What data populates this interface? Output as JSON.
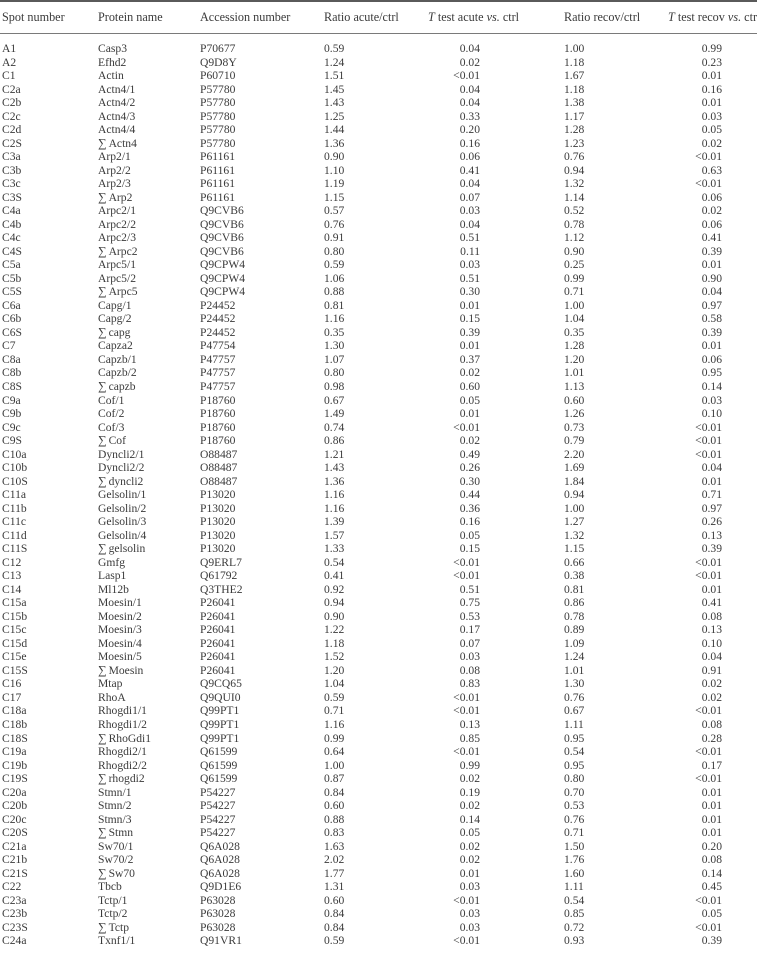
{
  "table": {
    "headers": [
      {
        "text": "Spot number"
      },
      {
        "text": "Protein name"
      },
      {
        "text": "Accession number"
      },
      {
        "text": "Ratio acute/ctrl"
      },
      {
        "italic": "T",
        "text": " test acute ",
        "italic2": "vs.",
        "text2": " ctrl"
      },
      {
        "text": "Ratio recov/ctrl"
      },
      {
        "italic": "T",
        "text": " test recov ",
        "italic2": "vs.",
        "text2": " ctrl"
      }
    ],
    "rows": [
      {
        "spot": "A1",
        "sum": false,
        "name": "Casp3",
        "acc": "P70677",
        "ra": "0.59",
        "ta": "0.04",
        "rr": "1.00",
        "tr": "0.99"
      },
      {
        "spot": "A2",
        "sum": false,
        "name": "Efhd2",
        "acc": "Q9D8Y",
        "ra": "1.24",
        "ta": "0.02",
        "rr": "1.18",
        "tr": "0.23"
      },
      {
        "spot": "C1",
        "sum": false,
        "name": "Actin",
        "acc": "P60710",
        "ra": "1.51",
        "ta": "<0.01",
        "rr": "1.67",
        "tr": "0.01"
      },
      {
        "spot": "C2a",
        "sum": false,
        "name": "Actn4/1",
        "acc": "P57780",
        "ra": "1.45",
        "ta": "0.04",
        "rr": "1.18",
        "tr": "0.16"
      },
      {
        "spot": "C2b",
        "sum": false,
        "name": "Actn4/2",
        "acc": "P57780",
        "ra": "1.43",
        "ta": "0.04",
        "rr": "1.38",
        "tr": "0.01"
      },
      {
        "spot": "C2c",
        "sum": false,
        "name": "Actn4/3",
        "acc": "P57780",
        "ra": "1.25",
        "ta": "0.33",
        "rr": "1.17",
        "tr": "0.03"
      },
      {
        "spot": "C2d",
        "sum": false,
        "name": "Actn4/4",
        "acc": "P57780",
        "ra": "1.44",
        "ta": "0.20",
        "rr": "1.28",
        "tr": "0.05"
      },
      {
        "spot": "C2S",
        "sum": true,
        "name": "Actn4",
        "acc": "P57780",
        "ra": "1.36",
        "ta": "0.16",
        "rr": "1.23",
        "tr": "0.02"
      },
      {
        "spot": "C3a",
        "sum": false,
        "name": "Arp2/1",
        "acc": "P61161",
        "ra": "0.90",
        "ta": "0.06",
        "rr": "0.76",
        "tr": "<0.01"
      },
      {
        "spot": "C3b",
        "sum": false,
        "name": "Arp2/2",
        "acc": "P61161",
        "ra": "1.10",
        "ta": "0.41",
        "rr": "0.94",
        "tr": "0.63"
      },
      {
        "spot": "C3c",
        "sum": false,
        "name": "Arp2/3",
        "acc": "P61161",
        "ra": "1.19",
        "ta": "0.04",
        "rr": "1.32",
        "tr": "<0.01"
      },
      {
        "spot": "C3S",
        "sum": true,
        "name": "Arp2",
        "acc": "P61161",
        "ra": "1.15",
        "ta": "0.07",
        "rr": "1.14",
        "tr": "0.06"
      },
      {
        "spot": "C4a",
        "sum": false,
        "name": "Arpc2/1",
        "acc": "Q9CVB6",
        "ra": "0.57",
        "ta": "0.03",
        "rr": "0.52",
        "tr": "0.02"
      },
      {
        "spot": "C4b",
        "sum": false,
        "name": "Arpc2/2",
        "acc": "Q9CVB6",
        "ra": "0.76",
        "ta": "0.04",
        "rr": "0.78",
        "tr": "0.06"
      },
      {
        "spot": "C4c",
        "sum": false,
        "name": "Arpc2/3",
        "acc": "Q9CVB6",
        "ra": "0.91",
        "ta": "0.51",
        "rr": "1.12",
        "tr": "0.41"
      },
      {
        "spot": "C4S",
        "sum": true,
        "name": "Arpc2",
        "acc": "Q9CVB6",
        "ra": "0.80",
        "ta": "0.11",
        "rr": "0.90",
        "tr": "0.39"
      },
      {
        "spot": "C5a",
        "sum": false,
        "name": "Arpc5/1",
        "acc": "Q9CPW4",
        "ra": "0.59",
        "ta": "0.03",
        "rr": "0.25",
        "tr": "0.01"
      },
      {
        "spot": "C5b",
        "sum": false,
        "name": "Arpc5/2",
        "acc": "Q9CPW4",
        "ra": "1.06",
        "ta": "0.51",
        "rr": "0.99",
        "tr": "0.90"
      },
      {
        "spot": "C5S",
        "sum": true,
        "name": "Arpc5",
        "acc": "Q9CPW4",
        "ra": "0.88",
        "ta": "0.30",
        "rr": "0.71",
        "tr": "0.04"
      },
      {
        "spot": "C6a",
        "sum": false,
        "name": "Capg/1",
        "acc": "P24452",
        "ra": "0.81",
        "ta": "0.01",
        "rr": "1.00",
        "tr": "0.97"
      },
      {
        "spot": "C6b",
        "sum": false,
        "name": "Capg/2",
        "acc": "P24452",
        "ra": "1.16",
        "ta": "0.15",
        "rr": "1.04",
        "tr": "0.58"
      },
      {
        "spot": "C6S",
        "sum": true,
        "name": "capg",
        "acc": "P24452",
        "ra": "0.35",
        "ta": "0.39",
        "rr": "0.35",
        "tr": "0.39"
      },
      {
        "spot": "C7",
        "sum": false,
        "name": "Capza2",
        "acc": "P47754",
        "ra": "1.30",
        "ta": "0.01",
        "rr": "1.28",
        "tr": "0.01"
      },
      {
        "spot": "C8a",
        "sum": false,
        "name": "Capzb/1",
        "acc": "P47757",
        "ra": "1.07",
        "ta": "0.37",
        "rr": "1.20",
        "tr": "0.06"
      },
      {
        "spot": "C8b",
        "sum": false,
        "name": "Capzb/2",
        "acc": "P47757",
        "ra": "0.80",
        "ta": "0.02",
        "rr": "1.01",
        "tr": "0.95"
      },
      {
        "spot": "C8S",
        "sum": true,
        "name": "capzb",
        "acc": "P47757",
        "ra": "0.98",
        "ta": "0.60",
        "rr": "1.13",
        "tr": "0.14"
      },
      {
        "spot": "C9a",
        "sum": false,
        "name": "Cof/1",
        "acc": "P18760",
        "ra": "0.67",
        "ta": "0.05",
        "rr": "0.60",
        "tr": "0.03"
      },
      {
        "spot": "C9b",
        "sum": false,
        "name": "Cof/2",
        "acc": "P18760",
        "ra": "1.49",
        "ta": "0.01",
        "rr": "1.26",
        "tr": "0.10"
      },
      {
        "spot": "C9c",
        "sum": false,
        "name": "Cof/3",
        "acc": "P18760",
        "ra": "0.74",
        "ta": "<0.01",
        "rr": "0.73",
        "tr": "<0.01"
      },
      {
        "spot": "C9S",
        "sum": true,
        "name": "Cof",
        "acc": "P18760",
        "ra": "0.86",
        "ta": "0.02",
        "rr": "0.79",
        "tr": "<0.01"
      },
      {
        "spot": "C10a",
        "sum": false,
        "name": "Dyncli2/1",
        "acc": "O88487",
        "ra": "1.21",
        "ta": "0.49",
        "rr": "2.20",
        "tr": "<0.01"
      },
      {
        "spot": "C10b",
        "sum": false,
        "name": "Dyncli2/2",
        "acc": "O88487",
        "ra": "1.43",
        "ta": "0.26",
        "rr": "1.69",
        "tr": "0.04"
      },
      {
        "spot": "C10S",
        "sum": true,
        "name": "dyncli2",
        "acc": "O88487",
        "ra": "1.36",
        "ta": "0.30",
        "rr": "1.84",
        "tr": "0.01"
      },
      {
        "spot": "C11a",
        "sum": false,
        "name": "Gelsolin/1",
        "acc": "P13020",
        "ra": "1.16",
        "ta": "0.44",
        "rr": "0.94",
        "tr": "0.71"
      },
      {
        "spot": "C11b",
        "sum": false,
        "name": "Gelsolin/2",
        "acc": "P13020",
        "ra": "1.16",
        "ta": "0.36",
        "rr": "1.00",
        "tr": "0.97"
      },
      {
        "spot": "C11c",
        "sum": false,
        "name": "Gelsolin/3",
        "acc": "P13020",
        "ra": "1.39",
        "ta": "0.16",
        "rr": "1.27",
        "tr": "0.26"
      },
      {
        "spot": "C11d",
        "sum": false,
        "name": "Gelsolin/4",
        "acc": "P13020",
        "ra": "1.57",
        "ta": "0.05",
        "rr": "1.32",
        "tr": "0.13"
      },
      {
        "spot": "C11S",
        "sum": true,
        "name": "gelsolin",
        "acc": "P13020",
        "ra": "1.33",
        "ta": "0.15",
        "rr": "1.15",
        "tr": "0.39"
      },
      {
        "spot": "C12",
        "sum": false,
        "name": "Gmfg",
        "acc": "Q9ERL7",
        "ra": "0.54",
        "ta": "<0.01",
        "rr": "0.66",
        "tr": "<0.01"
      },
      {
        "spot": "C13",
        "sum": false,
        "name": "Lasp1",
        "acc": "Q61792",
        "ra": "0.41",
        "ta": "<0.01",
        "rr": "0.38",
        "tr": "<0.01"
      },
      {
        "spot": "C14",
        "sum": false,
        "name": "Ml12b",
        "acc": "Q3THE2",
        "ra": "0.92",
        "ta": "0.51",
        "rr": "0.81",
        "tr": "0.01"
      },
      {
        "spot": "C15a",
        "sum": false,
        "name": "Moesin/1",
        "acc": "P26041",
        "ra": "0.94",
        "ta": "0.75",
        "rr": "0.86",
        "tr": "0.41"
      },
      {
        "spot": "C15b",
        "sum": false,
        "name": "Moesin/2",
        "acc": "P26041",
        "ra": "0.90",
        "ta": "0.53",
        "rr": "0.78",
        "tr": "0.08"
      },
      {
        "spot": "C15c",
        "sum": false,
        "name": "Moesin/3",
        "acc": "P26041",
        "ra": "1.22",
        "ta": "0.17",
        "rr": "0.89",
        "tr": "0.13"
      },
      {
        "spot": "C15d",
        "sum": false,
        "name": "Moesin/4",
        "acc": "P26041",
        "ra": "1.18",
        "ta": "0.07",
        "rr": "1.09",
        "tr": "0.10"
      },
      {
        "spot": "C15e",
        "sum": false,
        "name": "Moesin/5",
        "acc": "P26041",
        "ra": "1.52",
        "ta": "0.03",
        "rr": "1.24",
        "tr": "0.04"
      },
      {
        "spot": "C15S",
        "sum": true,
        "name": "Moesin",
        "acc": "P26041",
        "ra": "1.20",
        "ta": "0.08",
        "rr": "1.01",
        "tr": "0.91"
      },
      {
        "spot": "C16",
        "sum": false,
        "name": "Mtap",
        "acc": "Q9CQ65",
        "ra": "1.04",
        "ta": "0.83",
        "rr": "1.30",
        "tr": "0.02"
      },
      {
        "spot": "C17",
        "sum": false,
        "name": "RhoA",
        "acc": "Q9QUI0",
        "ra": "0.59",
        "ta": "<0.01",
        "rr": "0.76",
        "tr": "0.02"
      },
      {
        "spot": "C18a",
        "sum": false,
        "name": "Rhogdi1/1",
        "acc": "Q99PT1",
        "ra": "0.71",
        "ta": "<0.01",
        "rr": "0.67",
        "tr": "<0.01"
      },
      {
        "spot": "C18b",
        "sum": false,
        "name": "Rhogdi1/2",
        "acc": "Q99PT1",
        "ra": "1.16",
        "ta": "0.13",
        "rr": "1.11",
        "tr": "0.08"
      },
      {
        "spot": "C18S",
        "sum": true,
        "name": "RhoGdi1",
        "acc": "Q99PT1",
        "ra": "0.99",
        "ta": "0.85",
        "rr": "0.95",
        "tr": "0.28"
      },
      {
        "spot": "C19a",
        "sum": false,
        "name": "Rhogdi2/1",
        "acc": "Q61599",
        "ra": "0.64",
        "ta": "<0.01",
        "rr": "0.54",
        "tr": "<0.01"
      },
      {
        "spot": "C19b",
        "sum": false,
        "name": "Rhogdi2/2",
        "acc": "Q61599",
        "ra": "1.00",
        "ta": "0.99",
        "rr": "0.95",
        "tr": "0.17"
      },
      {
        "spot": "C19S",
        "sum": true,
        "name": "rhogdi2",
        "acc": "Q61599",
        "ra": "0.87",
        "ta": "0.02",
        "rr": "0.80",
        "tr": "<0.01"
      },
      {
        "spot": "C20a",
        "sum": false,
        "name": "Stmn/1",
        "acc": "P54227",
        "ra": "0.84",
        "ta": "0.19",
        "rr": "0.70",
        "tr": "0.01"
      },
      {
        "spot": "C20b",
        "sum": false,
        "name": "Stmn/2",
        "acc": "P54227",
        "ra": "0.60",
        "ta": "0.02",
        "rr": "0.53",
        "tr": "0.01"
      },
      {
        "spot": "C20c",
        "sum": false,
        "name": "Stmn/3",
        "acc": "P54227",
        "ra": "0.88",
        "ta": "0.14",
        "rr": "0.76",
        "tr": "0.01"
      },
      {
        "spot": "C20S",
        "sum": true,
        "name": "Stmn",
        "acc": "P54227",
        "ra": "0.83",
        "ta": "0.05",
        "rr": "0.71",
        "tr": "0.01"
      },
      {
        "spot": "C21a",
        "sum": false,
        "name": "Sw70/1",
        "acc": "Q6A028",
        "ra": "1.63",
        "ta": "0.02",
        "rr": "1.50",
        "tr": "0.20"
      },
      {
        "spot": "C21b",
        "sum": false,
        "name": "Sw70/2",
        "acc": "Q6A028",
        "ra": "2.02",
        "ta": "0.02",
        "rr": "1.76",
        "tr": "0.08"
      },
      {
        "spot": "C21S",
        "sum": true,
        "name": "Sw70",
        "acc": "Q6A028",
        "ra": "1.77",
        "ta": "0.01",
        "rr": "1.60",
        "tr": "0.14"
      },
      {
        "spot": "C22",
        "sum": false,
        "name": "Tbcb",
        "acc": "Q9D1E6",
        "ra": "1.31",
        "ta": "0.03",
        "rr": "1.11",
        "tr": "0.45"
      },
      {
        "spot": "C23a",
        "sum": false,
        "name": "Tctp/1",
        "acc": "P63028",
        "ra": "0.60",
        "ta": "<0.01",
        "rr": "0.54",
        "tr": "<0.01"
      },
      {
        "spot": "C23b",
        "sum": false,
        "name": "Tctp/2",
        "acc": "P63028",
        "ra": "0.84",
        "ta": "0.03",
        "rr": "0.85",
        "tr": "0.05"
      },
      {
        "spot": "C23S",
        "sum": true,
        "name": "Tctp",
        "acc": "P63028",
        "ra": "0.84",
        "ta": "0.03",
        "rr": "0.72",
        "tr": "<0.01"
      },
      {
        "spot": "C24a",
        "sum": false,
        "name": "Txnf1/1",
        "acc": "Q91VR1",
        "ra": "0.59",
        "ta": "<0.01",
        "rr": "0.93",
        "tr": "0.39"
      }
    ],
    "sum_symbol": "∑"
  }
}
